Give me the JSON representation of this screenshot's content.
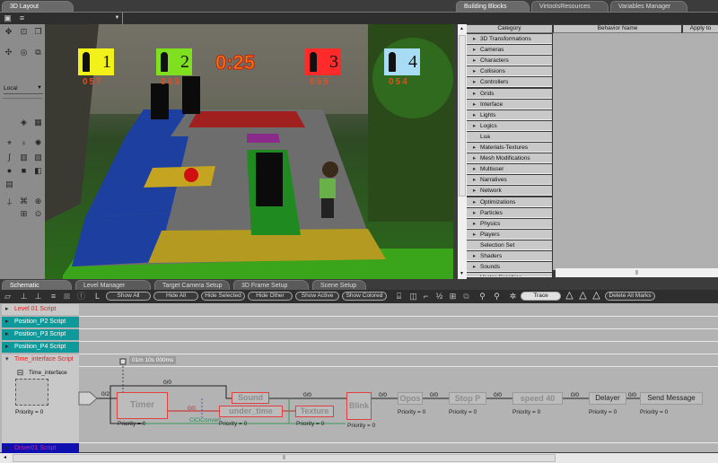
{
  "layout_panel": {
    "tab": "3D Layout",
    "coord_mode": "Local",
    "hud": {
      "players": [
        {
          "number": "1",
          "score": "057",
          "color": "#f2f21a"
        },
        {
          "number": "2",
          "score": "063",
          "color": "#7fe020"
        },
        {
          "number": "3",
          "score": "055",
          "color": "#ff2a2a"
        },
        {
          "number": "4",
          "score": "054",
          "color": "#a8dcf5"
        }
      ],
      "timer": "0:25"
    }
  },
  "right_panel": {
    "tabs": [
      "Building Blocks",
      "VirtoolsResources",
      "Variables Manager"
    ],
    "columns": [
      "Category",
      "Behavior Name",
      "Apply to"
    ],
    "categories": [
      {
        "label": "3D Transformations",
        "expandable": true
      },
      {
        "label": "Cameras",
        "expandable": true
      },
      {
        "label": "Characters",
        "expandable": true
      },
      {
        "label": "Collisions",
        "expandable": true
      },
      {
        "label": "Controllers",
        "expandable": true
      },
      {
        "label": "Grids",
        "expandable": true
      },
      {
        "label": "Interface",
        "expandable": true
      },
      {
        "label": "Lights",
        "expandable": true
      },
      {
        "label": "Logics",
        "expandable": true
      },
      {
        "label": "Lua",
        "expandable": false
      },
      {
        "label": "Materials-Textures",
        "expandable": true
      },
      {
        "label": "Mesh Modifications",
        "expandable": true
      },
      {
        "label": "Multiuser",
        "expandable": true
      },
      {
        "label": "Narratives",
        "expandable": true
      },
      {
        "label": "Network",
        "expandable": true
      },
      {
        "label": "Optimizations",
        "expandable": true
      },
      {
        "label": "Particles",
        "expandable": true
      },
      {
        "label": "Physics",
        "expandable": true
      },
      {
        "label": "Players",
        "expandable": true
      },
      {
        "label": "Selection Set",
        "expandable": false
      },
      {
        "label": "Shaders",
        "expandable": true
      },
      {
        "label": "Sounds",
        "expandable": true
      },
      {
        "label": "Vector Graphics",
        "expandable": false
      }
    ]
  },
  "bottom_panel": {
    "tabs": [
      "Schematic",
      "Level Manager",
      "Target Camera Setup",
      "3D Frame Setup",
      "Scene Setup"
    ],
    "toolbar": {
      "buttons": [
        "Show All",
        "Hide All",
        "Hide Selected",
        "Hide Other",
        "Show Active",
        "Show Colored"
      ],
      "trace": "Trace",
      "delete_marks": "Delete All Marks",
      "l_label": "L"
    },
    "scripts": [
      {
        "label": "Level 01 Script",
        "color": "#e02020",
        "bg": "#c8c8c8"
      },
      {
        "label": "Position_P2 Script",
        "color": "#ffffff",
        "bg": "#0e9a9a"
      },
      {
        "label": "Position_P3 Script",
        "color": "#ffffff",
        "bg": "#0e9a9a"
      },
      {
        "label": "Position_P4 Script",
        "color": "#ffffff",
        "bg": "#0e9a9a"
      },
      {
        "label": "Time_interface Script",
        "color": "#e02020",
        "bg": "#c8c8c8"
      },
      {
        "label": "Driver01 Script",
        "color": "#e0208a",
        "bg": "#1010b0"
      }
    ],
    "script_owner": {
      "name": "Time_interface",
      "priority": "Priority = 0"
    },
    "graph": {
      "timer_param": "01m 10s 000ms",
      "entry_link": "0/2",
      "nodes": [
        {
          "label": "Timer",
          "priority": "Priority = 0"
        },
        {
          "label": "Sound"
        },
        {
          "label": "under_time",
          "priority": "Priority = 0"
        },
        {
          "label": "Texture",
          "priority": "Priority = 0"
        },
        {
          "label": "Blink",
          "priority": "Priority = 0"
        },
        {
          "label": "Opos",
          "priority": "Priority = 0"
        },
        {
          "label": "Stop P",
          "priority": "Priority = 0"
        },
        {
          "label": "speed 40",
          "priority": "Priority = 0"
        },
        {
          "label": "Delayer",
          "priority": "Priority = 0"
        },
        {
          "label": "Send Message",
          "priority": "Priority = 0"
        }
      ],
      "links": [
        "0/0",
        "0/0",
        "0/0",
        "0/0",
        "0/0",
        "0/0",
        "0/0",
        "0/0",
        "0/0"
      ],
      "converter": "CiCiConvert"
    }
  }
}
